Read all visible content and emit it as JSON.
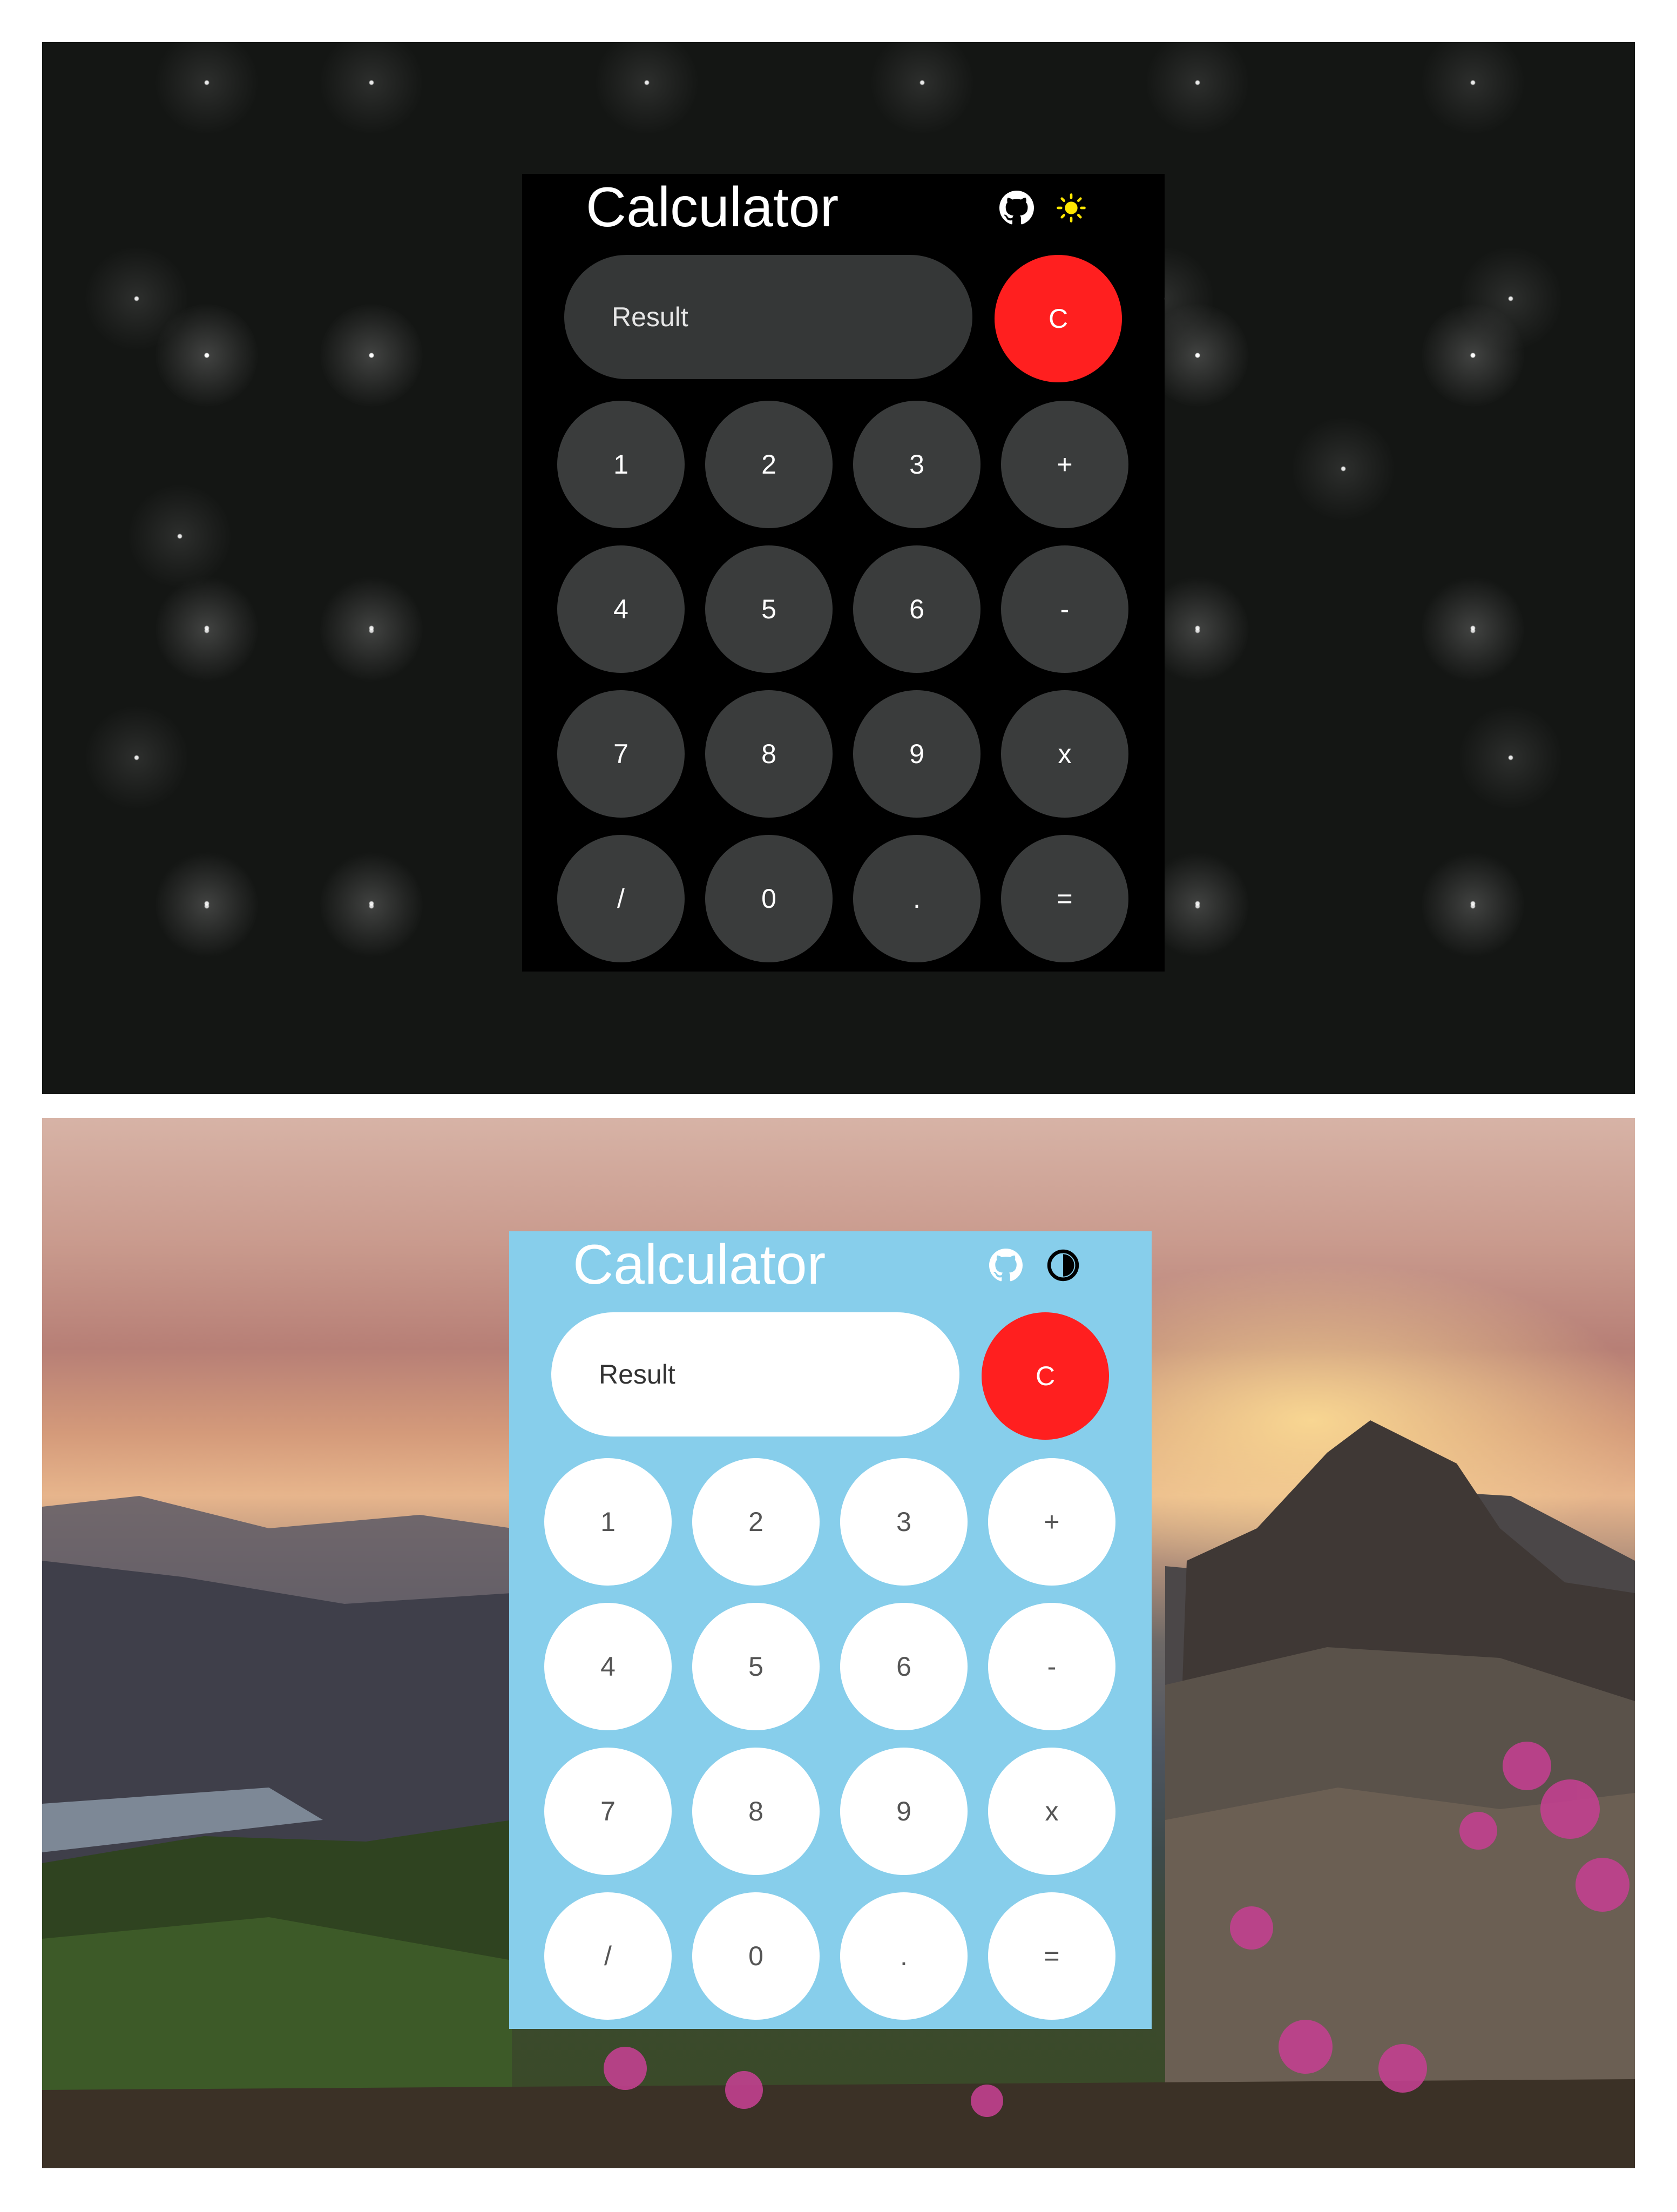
{
  "screens": [
    {
      "theme": "dark",
      "title": "Calculator",
      "icons": {
        "repo": "github-icon",
        "theme_toggle": "sun-icon"
      },
      "result_placeholder": "Result",
      "clear_label": "C",
      "keys": [
        "1",
        "2",
        "3",
        "+",
        "4",
        "5",
        "6",
        "-",
        "7",
        "8",
        "9",
        "x",
        "/",
        "0",
        ".",
        "="
      ],
      "colors": {
        "background": "#141614",
        "calculator": "#000000",
        "key": "#3a3c3c",
        "key_text": "#ffffff",
        "clear": "#ff1f1f",
        "sun_icon": "#ffe600"
      }
    },
    {
      "theme": "light",
      "title": "Calculator",
      "icons": {
        "repo": "github-icon",
        "theme_toggle": "contrast-icon"
      },
      "result_placeholder": "Result",
      "clear_label": "C",
      "keys": [
        "1",
        "2",
        "3",
        "+",
        "4",
        "5",
        "6",
        "-",
        "7",
        "8",
        "9",
        "x",
        "/",
        "0",
        ".",
        "="
      ],
      "colors": {
        "background": "landscape-photo",
        "calculator": "#87ceeb",
        "key": "#ffffff",
        "key_text": "#555555",
        "clear": "#ff1f1f"
      }
    }
  ]
}
